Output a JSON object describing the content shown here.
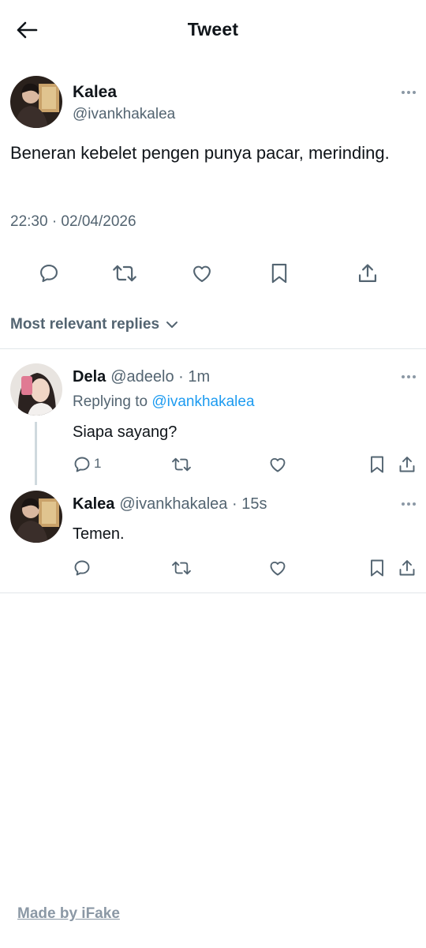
{
  "header": {
    "title": "Tweet"
  },
  "main_tweet": {
    "name": "Kalea",
    "handle": "@ivankhakalea",
    "text": "Beneran kebelet pengen punya pacar, merinding.",
    "timestamp": "22:30 · 02/04/2026"
  },
  "sort": {
    "label": "Most relevant replies"
  },
  "replies": [
    {
      "name": "Dela",
      "meta": "@adeelo · 1m",
      "replying_prefix": "Replying to",
      "replying_to": "@ivankhakalea",
      "text": "Siapa sayang?",
      "reply_count": "1"
    },
    {
      "name": "Kalea",
      "meta": "@ivankhakalea · 15s",
      "text": "Temen."
    }
  ],
  "footer": {
    "text": "Made by iFake"
  },
  "colors": {
    "text": "#0f1419",
    "secondary": "#536471",
    "link": "#1d9bf0",
    "divider": "#e1e6ea"
  }
}
